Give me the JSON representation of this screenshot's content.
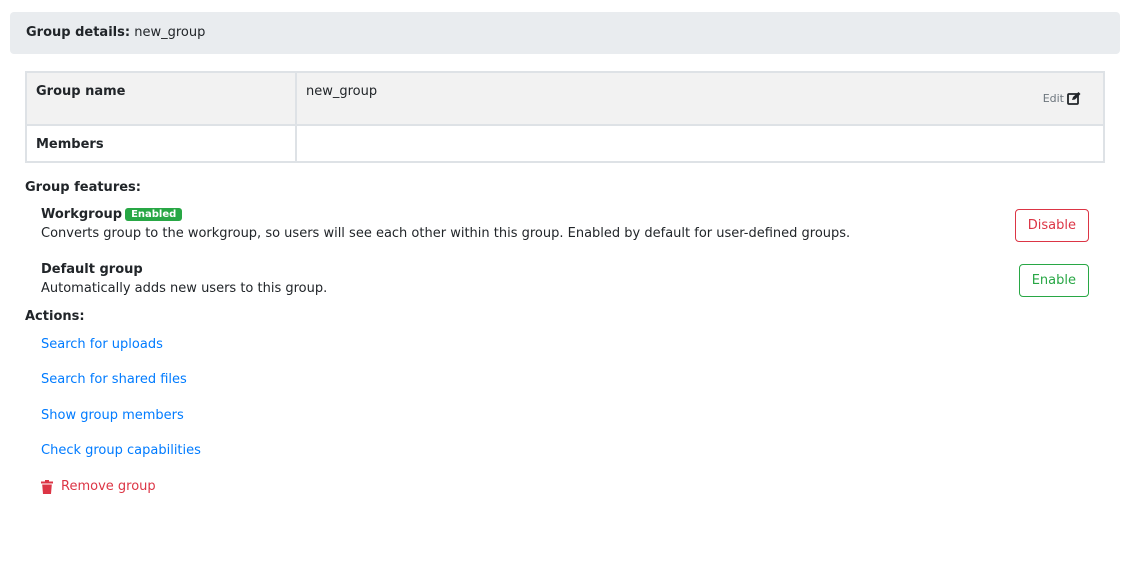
{
  "header": {
    "label": "Group details:",
    "group_name": "new_group"
  },
  "details": {
    "rows": [
      {
        "label": "Group name",
        "value": "new_group",
        "edit_label": "Edit"
      },
      {
        "label": "Members",
        "value": ""
      }
    ]
  },
  "features": {
    "title": "Group features:",
    "items": [
      {
        "name": "Workgroup",
        "badge": "Enabled",
        "description": "Converts group to the workgroup, so users will see each other within this group. Enabled by default for user-defined groups.",
        "button": "Disable"
      },
      {
        "name": "Default group",
        "description": "Automatically adds new users to this group.",
        "button": "Enable"
      }
    ]
  },
  "actions": {
    "title": "Actions:",
    "links": [
      {
        "label": "Search for uploads"
      },
      {
        "label": "Search for shared files"
      },
      {
        "label": "Show group members"
      },
      {
        "label": "Check group capabilities"
      },
      {
        "label": "Remove group",
        "icon": "trash-icon"
      }
    ]
  },
  "colors": {
    "link": "#007bff",
    "danger": "#dc3545",
    "success": "#28a745",
    "header_bg": "#e9ecef"
  }
}
